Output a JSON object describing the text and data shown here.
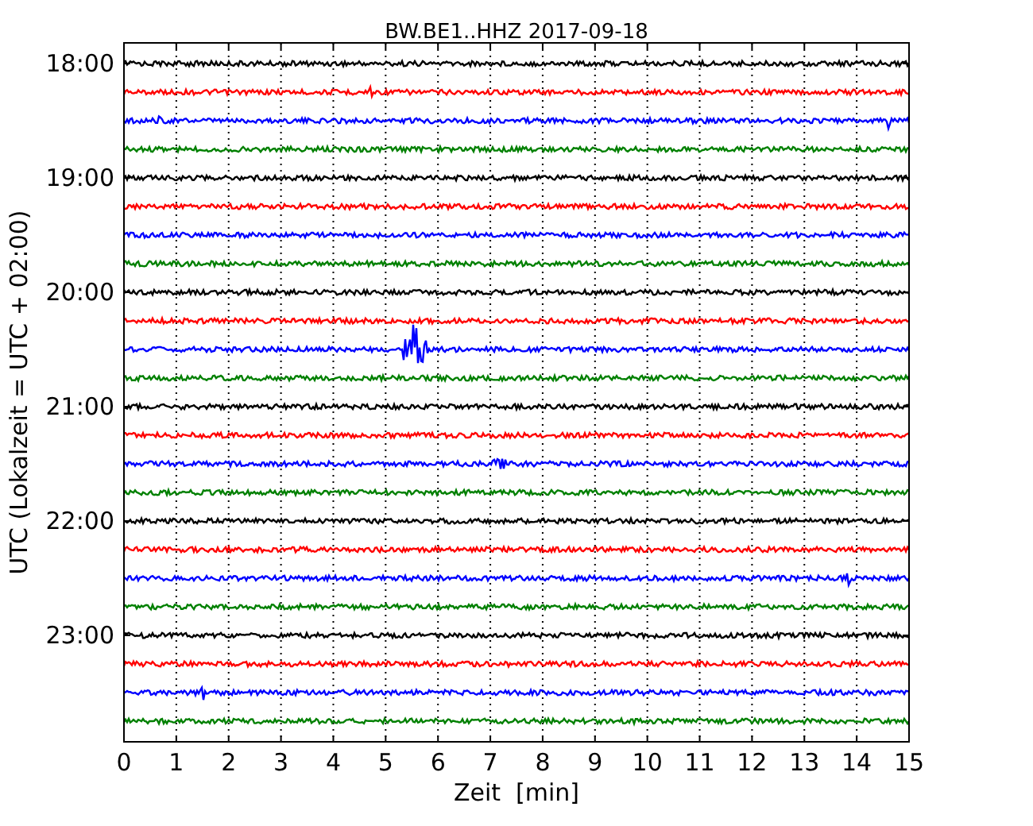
{
  "chart": {
    "title": "BW.BE1..HHZ 2017-09-18",
    "xlabel": "Zeit  [min]",
    "ylabel": "UTC (Lokalzeit = UTC + 02:00)",
    "xticks": [
      "0",
      "1",
      "2",
      "3",
      "4",
      "5",
      "6",
      "7",
      "8",
      "9",
      "10",
      "11",
      "12",
      "13",
      "14",
      "15"
    ],
    "time_labels": [
      "18:00",
      "19:00",
      "20:00",
      "21:00",
      "22:00",
      "23:00"
    ],
    "traces": [
      {
        "color": "#000000"
      },
      {
        "color": "#ff0000"
      },
      {
        "color": "#0000ff"
      },
      {
        "color": "#008000"
      },
      {
        "color": "#000000"
      },
      {
        "color": "#ff0000"
      },
      {
        "color": "#0000ff"
      },
      {
        "color": "#008000"
      },
      {
        "color": "#000000"
      },
      {
        "color": "#ff0000"
      },
      {
        "color": "#0000ff"
      },
      {
        "color": "#008000"
      },
      {
        "color": "#000000"
      },
      {
        "color": "#ff0000"
      },
      {
        "color": "#0000ff"
      },
      {
        "color": "#008000"
      },
      {
        "color": "#000000"
      },
      {
        "color": "#ff0000"
      },
      {
        "color": "#0000ff"
      },
      {
        "color": "#008000"
      },
      {
        "color": "#000000"
      },
      {
        "color": "#ff0000"
      },
      {
        "color": "#0000ff"
      },
      {
        "color": "#008000"
      }
    ]
  }
}
